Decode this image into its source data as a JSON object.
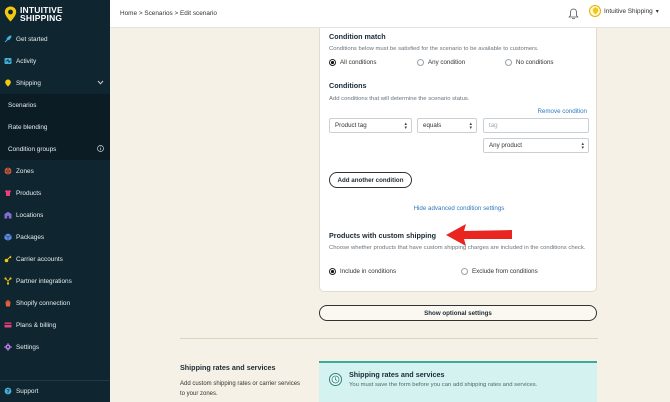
{
  "app": {
    "logo_line1": "INTUITIVE",
    "logo_line2": "SHIPPING"
  },
  "sidebar": {
    "items": [
      {
        "label": "Get started",
        "icon": "rocket-icon"
      },
      {
        "label": "Activity",
        "icon": "activity-icon"
      },
      {
        "label": "Shipping",
        "icon": "shipping-icon",
        "expanded": true
      },
      {
        "label": "Scenarios",
        "sub": true
      },
      {
        "label": "Rate blending",
        "sub": true
      },
      {
        "label": "Condition groups",
        "sub": true,
        "info_icon": "info-icon"
      },
      {
        "label": "Zones",
        "icon": "zones-icon"
      },
      {
        "label": "Products",
        "icon": "products-icon"
      },
      {
        "label": "Locations",
        "icon": "locations-icon"
      },
      {
        "label": "Packages",
        "icon": "packages-icon"
      },
      {
        "label": "Carrier accounts",
        "icon": "key-icon"
      },
      {
        "label": "Partner integrations",
        "icon": "integrations-icon"
      },
      {
        "label": "Shopify connection",
        "icon": "shopify-icon"
      },
      {
        "label": "Plans & billing",
        "icon": "billing-icon"
      },
      {
        "label": "Settings",
        "icon": "gear-icon"
      }
    ],
    "support": "Support"
  },
  "topbar": {
    "breadcrumb": "Home > Scenarios > Edit scenario",
    "account_name": "Intuitive Shipping",
    "account_caret": "▾"
  },
  "condition_match": {
    "title": "Condition match",
    "help": "Conditions below must be satisfied for the scenario to be available to customers.",
    "options": [
      "All conditions",
      "Any condition",
      "No conditions"
    ],
    "selected": "All conditions"
  },
  "conditions": {
    "title": "Conditions",
    "help": "Add conditions that will determine the scenario status.",
    "remove_link": "Remove condition",
    "field_select": "Product tag",
    "operator_select": "equals",
    "value_placeholder": "tag",
    "scope_select": "Any product",
    "add_button": "Add another condition",
    "hide_link": "Hide advanced condition settings"
  },
  "custom_shipping": {
    "title": "Products with custom shipping",
    "help": "Choose whether products that have custom shipping charges are included in the conditions check.",
    "options": [
      "Include in conditions",
      "Exclude from conditions"
    ],
    "selected": "Include in conditions"
  },
  "optional_button": "Show optional settings",
  "rates": {
    "title": "Shipping rates and services",
    "help": "Add custom shipping rates or carrier services to your zones.",
    "notice_title": "Shipping rates and services",
    "notice_text": "You must save the form before you can add shipping rates and services."
  },
  "colors": {
    "sidebar_bg": "#0f2530",
    "accent_yellow": "#f2c811",
    "link_blue": "#2f7ac0",
    "arrow_red": "#e8261f",
    "notice_bg": "#d4f2ef"
  }
}
